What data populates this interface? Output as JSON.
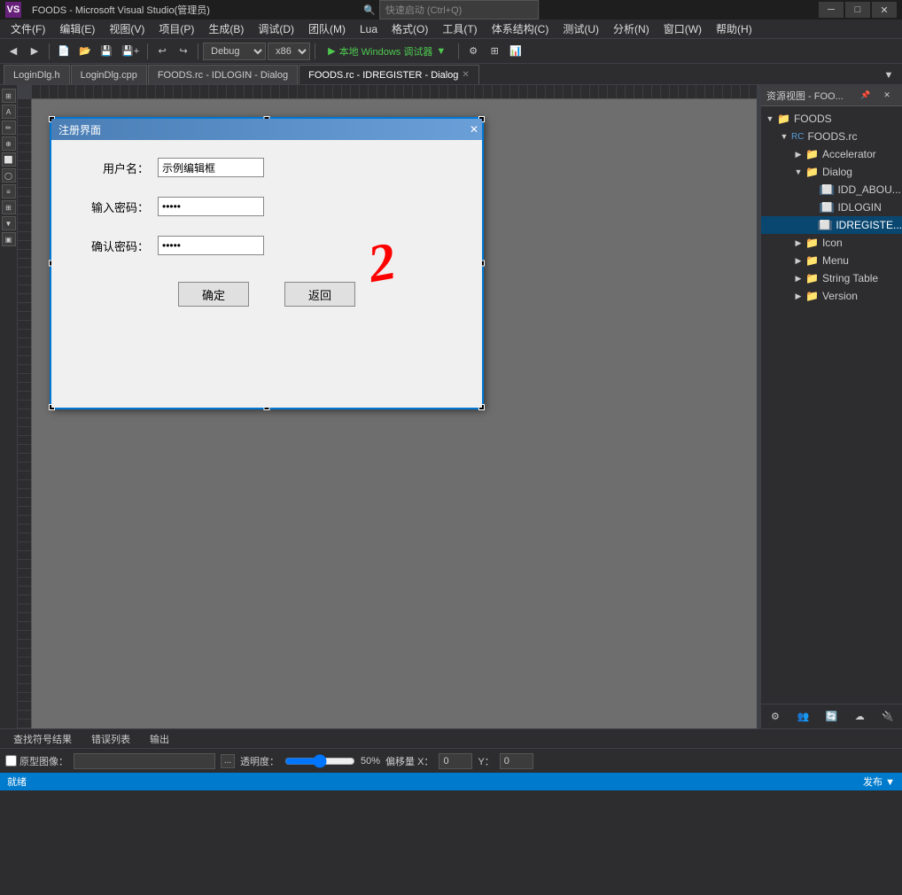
{
  "titlebar": {
    "title": "FOODS - Microsoft Visual Studio(管理员)",
    "min_btn": "─",
    "max_btn": "□",
    "close_btn": "✕",
    "quick_launch": "快速启动 (Ctrl+Q)"
  },
  "menubar": {
    "items": [
      {
        "label": "文件(F)"
      },
      {
        "label": "编辑(E)"
      },
      {
        "label": "视图(V)"
      },
      {
        "label": "项目(P)"
      },
      {
        "label": "生成(B)"
      },
      {
        "label": "调试(D)"
      },
      {
        "label": "团队(M)"
      },
      {
        "label": "Lua"
      },
      {
        "label": "格式(O)"
      },
      {
        "label": "工具(T)"
      },
      {
        "label": "体系结构(C)"
      },
      {
        "label": "测试(U)"
      },
      {
        "label": "分析(N)"
      },
      {
        "label": "窗口(W)"
      },
      {
        "label": "帮助(H)"
      }
    ]
  },
  "toolbar": {
    "config_label": "Debug",
    "platform_label": "x86",
    "run_label": "▶ 本地 Windows 调试器 ▼"
  },
  "tabs": [
    {
      "label": "LoginDlg.h",
      "active": false,
      "closable": false
    },
    {
      "label": "LoginDlg.cpp",
      "active": false,
      "closable": false
    },
    {
      "label": "FOODS.rc - IDLOGIN - Dialog",
      "active": false,
      "closable": false
    },
    {
      "label": "FOODS.rc - IDREGISTER - Dialog",
      "active": true,
      "closable": true
    }
  ],
  "dialog": {
    "title": "注册界面",
    "close_btn": "✕",
    "fields": [
      {
        "label": "用户名：",
        "value": "示例编辑框",
        "type": "text"
      },
      {
        "label": "输入密码：",
        "value": "•••••",
        "type": "password"
      },
      {
        "label": "确认密码：",
        "value": "•••••",
        "type": "password"
      }
    ],
    "buttons": [
      {
        "label": "确定"
      },
      {
        "label": "返回"
      }
    ]
  },
  "annotation": {
    "text": "2",
    "color": "red"
  },
  "right_panel": {
    "title": "资源视图 - FOO...",
    "pin_icon": "📌",
    "tree": {
      "root": "FOODS",
      "items": [
        {
          "label": "FOODS",
          "level": 0,
          "type": "folder",
          "expanded": true
        },
        {
          "label": "FOODS.rc",
          "level": 1,
          "type": "rc",
          "expanded": true
        },
        {
          "label": "Accelerator",
          "level": 2,
          "type": "folder",
          "expanded": false
        },
        {
          "label": "Dialog",
          "level": 2,
          "type": "folder",
          "expanded": true
        },
        {
          "label": "IDD_ABOU...",
          "level": 3,
          "type": "dialog"
        },
        {
          "label": "IDLOGIN",
          "level": 3,
          "type": "dialog"
        },
        {
          "label": "IDREGISTE...",
          "level": 3,
          "type": "dialog",
          "selected": true
        },
        {
          "label": "Icon",
          "level": 2,
          "type": "folder",
          "expanded": false
        },
        {
          "label": "Menu",
          "level": 2,
          "type": "folder",
          "expanded": false
        },
        {
          "label": "String Table",
          "level": 2,
          "type": "folder",
          "expanded": false
        },
        {
          "label": "Version",
          "level": 2,
          "type": "folder",
          "expanded": false
        }
      ]
    }
  },
  "bottom_tabs": [
    {
      "label": "查找符号结果"
    },
    {
      "label": "错误列表"
    },
    {
      "label": "输出"
    }
  ],
  "image_bar": {
    "checkbox_label": "原型图像：",
    "transparency_label": "透明度：",
    "transparency_value": "50%",
    "offset_x_label": "偏移量 X：",
    "offset_x_value": "0",
    "offset_y_label": "Y：",
    "offset_y_value": "0"
  },
  "statusbar": {
    "left_text": "就绪",
    "right_text": "发布 ▼"
  }
}
